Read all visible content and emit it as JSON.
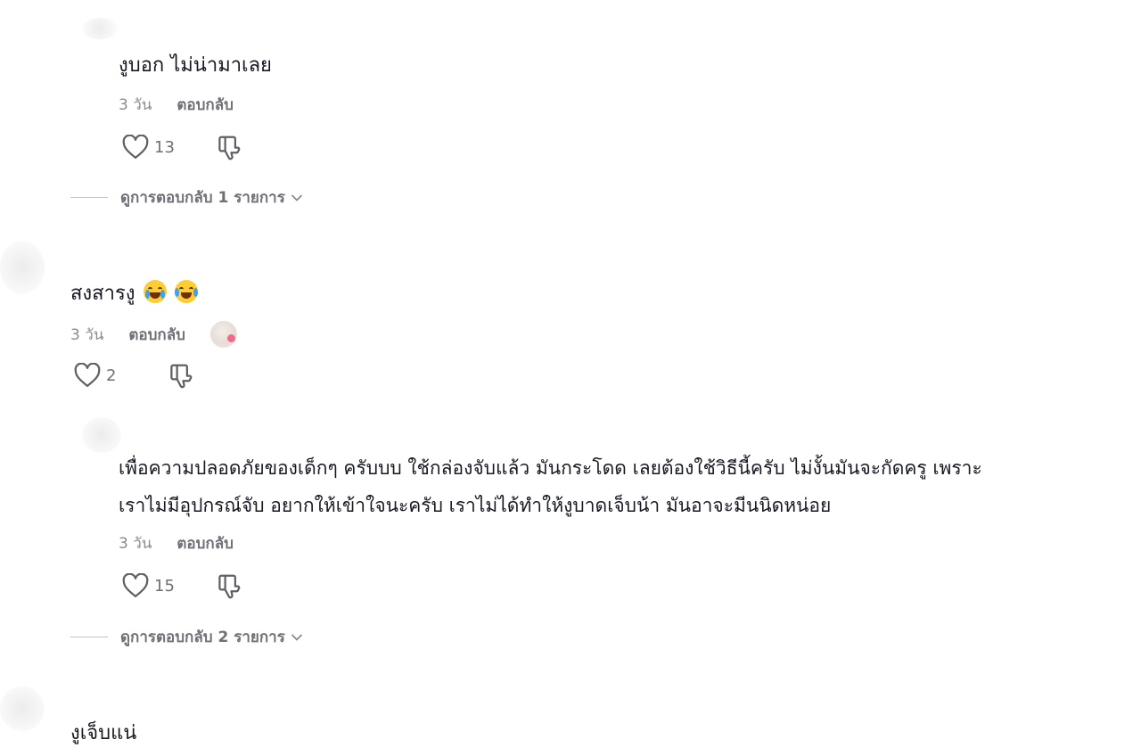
{
  "comments": [
    {
      "text": "งูบอก ไม่น่ามาเลย",
      "time": "3 วัน",
      "reply_label": "ตอบกลับ",
      "likes": "13",
      "view_replies": "ดูการตอบกลับ 1 รายการ"
    },
    {
      "text": "สงสารงู",
      "time": "3 วัน",
      "reply_label": "ตอบกลับ",
      "likes": "2"
    },
    {
      "text_line1": "เพื่อความปลอดภัยของเด็กๆ ครับบบ ใช้กล่องจับแล้ว มันกระโดด เลยต้องใช้วิธีนี้ครับ ไม่งั้นมันจะกัดครู เพราะ",
      "text_line2": "เราไม่มีอุปกรณ์จับ อยากให้เข้าใจนะครับ เราไม่ได้ทำให้งูบาดเจ็บน้า มันอาจะมีนนิดหน่อย",
      "time": "3 วัน",
      "reply_label": "ตอบกลับ",
      "likes": "15",
      "view_replies": "ดูการตอบกลับ 2 รายการ"
    },
    {
      "text": "งูเจ็บแน่"
    }
  ],
  "icons": {
    "like": "heart-outline-icon",
    "dislike": "thumbs-down-outline-icon",
    "expand": "chevron-down-icon"
  },
  "colors": {
    "text": "#161823",
    "meta": "#8a8b91",
    "action": "#6f7077"
  }
}
